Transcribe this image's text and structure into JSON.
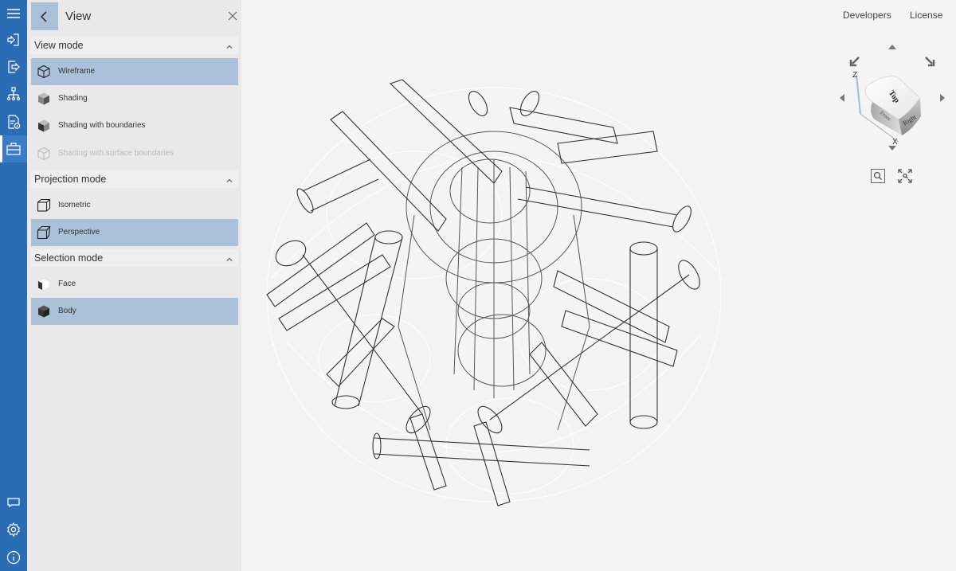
{
  "rail": {
    "items": [
      {
        "name": "menu",
        "icon": "hamburger-menu-icon"
      },
      {
        "name": "import",
        "icon": "import-icon"
      },
      {
        "name": "export",
        "icon": "export-icon"
      },
      {
        "name": "structure",
        "icon": "tree-structure-icon"
      },
      {
        "name": "properties",
        "icon": "document-info-icon"
      },
      {
        "name": "view",
        "icon": "toolbox-icon",
        "active": true
      }
    ],
    "bottom_items": [
      {
        "name": "feedback",
        "icon": "chat-bubble-icon"
      },
      {
        "name": "settings",
        "icon": "gear-icon"
      },
      {
        "name": "about",
        "icon": "info-icon"
      }
    ]
  },
  "panel": {
    "title": "View",
    "sections": [
      {
        "label": "View mode",
        "items": [
          {
            "label": "Wireframe",
            "icon": "wireframe-cube-icon",
            "selected": true,
            "disabled": false
          },
          {
            "label": "Shading",
            "icon": "shaded-cube-icon",
            "selected": false,
            "disabled": false
          },
          {
            "label": "Shading with boundaries",
            "icon": "shaded-boundary-cube-icon",
            "selected": false,
            "disabled": false
          },
          {
            "label": "Shading with surface boundaries",
            "icon": "surface-boundary-cube-icon",
            "selected": false,
            "disabled": true
          }
        ]
      },
      {
        "label": "Projection mode",
        "items": [
          {
            "label": "Isometric",
            "icon": "isometric-cube-icon",
            "selected": false,
            "disabled": false
          },
          {
            "label": "Perspective",
            "icon": "perspective-cube-icon",
            "selected": true,
            "disabled": false
          }
        ]
      },
      {
        "label": "Selection mode",
        "items": [
          {
            "label": "Face",
            "icon": "face-select-icon",
            "selected": false,
            "disabled": false
          },
          {
            "label": "Body",
            "icon": "body-select-icon",
            "selected": true,
            "disabled": false
          }
        ]
      }
    ]
  },
  "top_links": {
    "developers": "Developers",
    "license": "License"
  },
  "navcube": {
    "faces": {
      "top": "Top",
      "right": "Right",
      "front": "Front"
    },
    "axes": {
      "z": "Z",
      "x": "X"
    }
  },
  "colors": {
    "rail": "#2a6db5",
    "selected": "#aac1d9",
    "panel": "#e9e9e9",
    "viewport": "#f4f4f4"
  }
}
